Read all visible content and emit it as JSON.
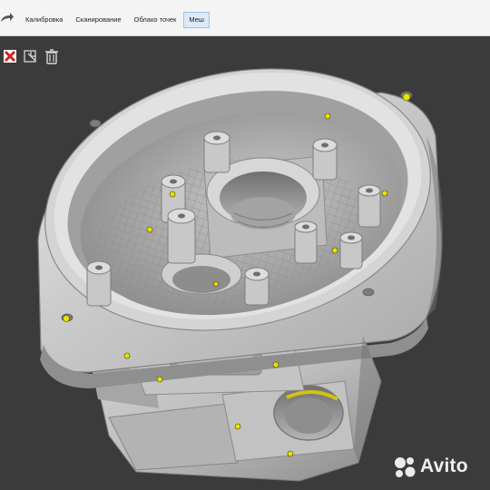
{
  "header": {
    "tabs": [
      {
        "label": "Калибровка",
        "active": false
      },
      {
        "label": "Сканирование",
        "active": false
      },
      {
        "label": "Облако точек",
        "active": false
      },
      {
        "label": "Меш",
        "active": true
      }
    ]
  },
  "toolbar": {
    "tools": [
      "crop-icon",
      "select-mesh-icon",
      "trash-icon"
    ]
  },
  "viewport": {
    "subject": "scanned-mesh-housing",
    "marker_color": "#e8e200",
    "mesh_color": "#b8b8b8",
    "background": "#3b3b3b"
  },
  "watermark": {
    "text": "Avito"
  }
}
